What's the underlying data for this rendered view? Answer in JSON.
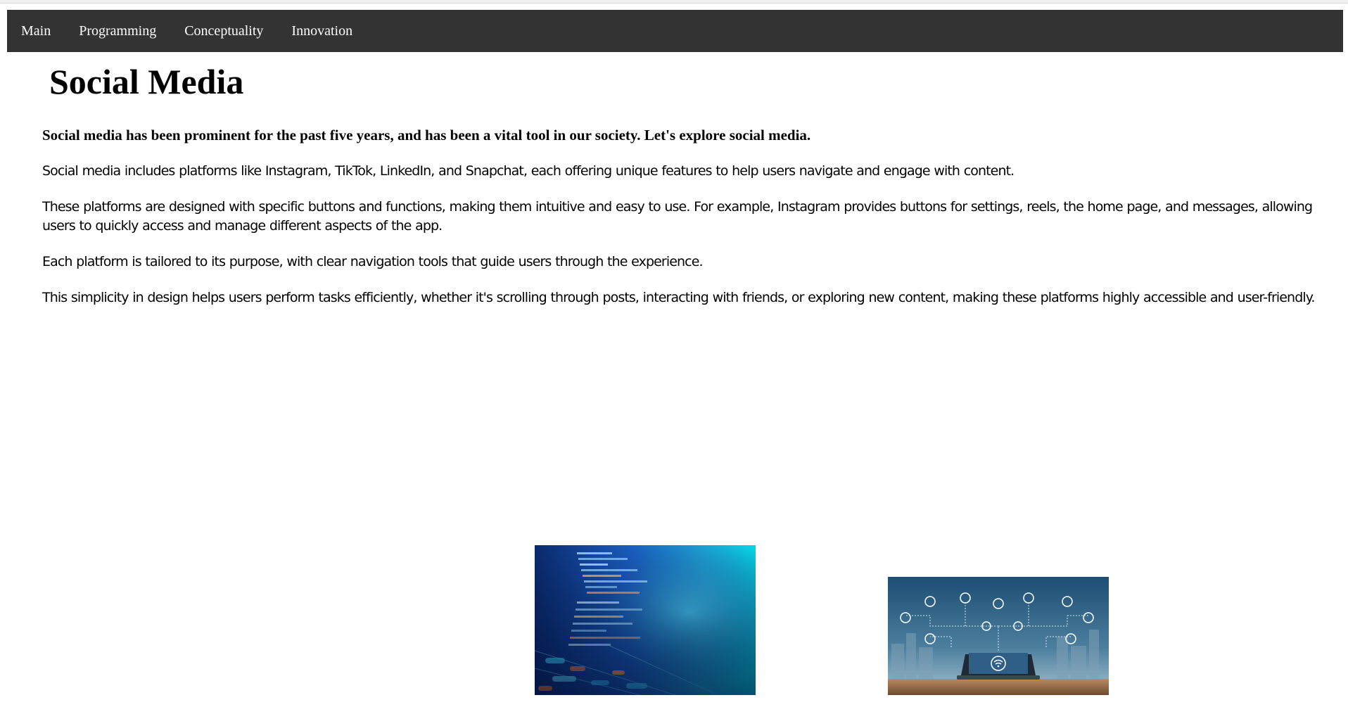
{
  "nav": {
    "items": [
      {
        "label": "Main"
      },
      {
        "label": "Programming"
      },
      {
        "label": "Conceptuality"
      },
      {
        "label": "Innovation"
      }
    ]
  },
  "page": {
    "title": "Social Media",
    "lead": "Social media has been prominent for the past five years, and has been a vital tool in our society. Let's explore social media.",
    "paragraphs": [
      "Social media includes platforms like Instagram, TikTok, LinkedIn, and Snapchat, each offering unique features to help users navigate and engage with content.",
      "These platforms are designed with specific buttons and functions, making them intuitive and easy to use. For example, Instagram provides buttons for settings, reels, the home page, and messages, allowing users to quickly access and manage different aspects of the app.",
      "Each platform is tailored to its purpose, with clear navigation tools that guide users through the experience.",
      "This simplicity in design helps users perform tasks efficiently, whether it's scrolling through posts, interacting with friends, or exploring new content, making these platforms highly accessible and user-friendly."
    ]
  },
  "colors": {
    "navbar_bg": "#333333",
    "nav_text": "#ffffff",
    "page_bg": "#ffffff",
    "text": "#000000"
  },
  "images": [
    {
      "subject": "code-on-screen-image"
    },
    {
      "subject": "network-laptop-image"
    }
  ]
}
